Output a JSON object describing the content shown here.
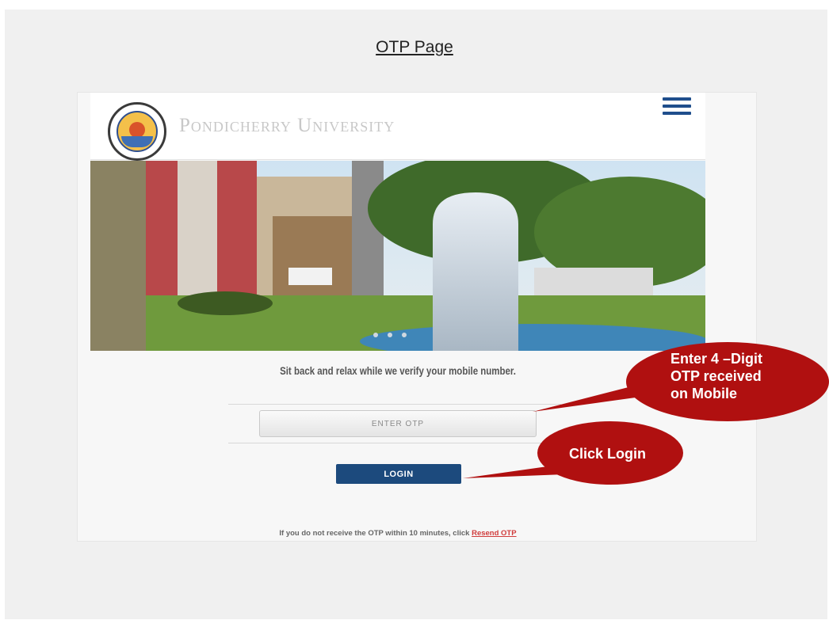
{
  "page": {
    "title": "OTP Page"
  },
  "app": {
    "university_name": "Pondicherry University",
    "menu_icon": "hamburger-menu-icon",
    "tagline": "Sit back and relax while we verify your mobile number.",
    "otp_placeholder": "ENTER OTP",
    "login_label": "LOGIN",
    "footer_text": "If you do not receive the OTP within 10 minutes, click ",
    "resend_label": "Resend OTP"
  },
  "callouts": {
    "otp": "Enter 4 –Digit OTP received on Mobile",
    "otp_lines": [
      "Enter 4 –Digit",
      "OTP received",
      "on Mobile"
    ],
    "login": "Click Login"
  },
  "colors": {
    "brand_blue": "#1c4a7d",
    "callout_red": "#b01010",
    "link_red": "#d03c3c"
  }
}
